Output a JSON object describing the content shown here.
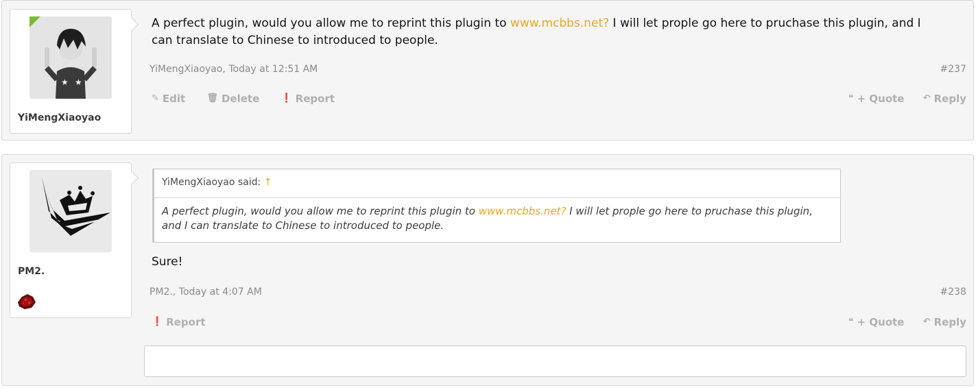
{
  "posts": [
    {
      "author": "YiMengXiaoyao",
      "avatar": "anime-boy-avatar",
      "online": true,
      "message_before_link": "A perfect plugin, would you allow me to reprint this plugin to ",
      "message_link": "www.mcbbs.net?",
      "message_after_link": " I will let prople go here to pruchase this plugin, and I can translate to Chinese to introduced to people.",
      "meta": "YiMengXiaoyao, Today at 12:51 AM",
      "post_number": "#237",
      "actions_left": [
        "Edit",
        "Delete",
        "Report"
      ],
      "actions_right": [
        "+ Quote",
        "Reply"
      ]
    },
    {
      "author": "PM2.",
      "avatar": "crown-logo-avatar",
      "badge": "redstone-icon",
      "quote": {
        "header": "YiMengXiaoyao said:",
        "arrow": "↑",
        "body_before_link": "A perfect plugin, would you allow me to reprint this plugin to ",
        "body_link": "www.mcbbs.net?",
        "body_after_link": " I will let prople go here to pruchase this plugin, and I can translate to Chinese to introduced to people."
      },
      "message": "Sure!",
      "meta": "PM2., Today at 4:07 AM",
      "post_number": "#238",
      "actions_left": [
        "Report"
      ],
      "actions_right": [
        "+ Quote",
        "Reply"
      ]
    }
  ],
  "colors": {
    "link": "#e8a721",
    "online": "#7fb93b",
    "muted": "#b0b0b0"
  }
}
